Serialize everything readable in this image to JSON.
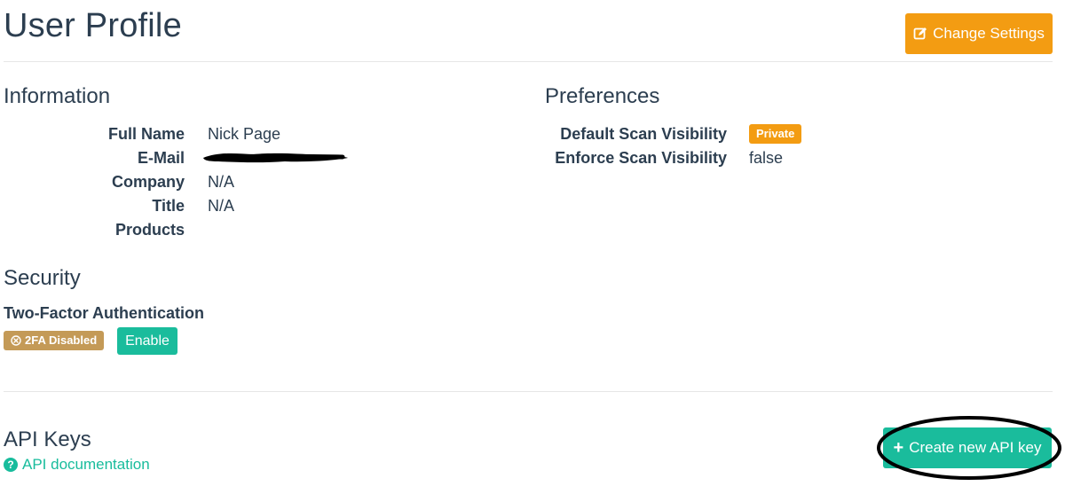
{
  "header": {
    "title": "User Profile",
    "change_settings_label": "Change Settings"
  },
  "information": {
    "heading": "Information",
    "fields": [
      {
        "label": "Full Name",
        "value": "Nick Page"
      },
      {
        "label": "E-Mail",
        "value": ""
      },
      {
        "label": "Company",
        "value": "N/A"
      },
      {
        "label": "Title",
        "value": "N/A"
      },
      {
        "label": "Products",
        "value": ""
      }
    ]
  },
  "preferences": {
    "heading": "Preferences",
    "fields": [
      {
        "label": "Default Scan Visibility",
        "value": "Private"
      },
      {
        "label": "Enforce Scan Visibility",
        "value": "false"
      }
    ]
  },
  "security": {
    "heading": "Security",
    "tfa_label": "Two-Factor Authentication",
    "tfa_status": "2FA Disabled",
    "enable_label": "Enable"
  },
  "api_keys": {
    "heading": "API Keys",
    "doc_link": "API documentation",
    "create_label": "Create new API key"
  },
  "colors": {
    "warning": "#f39c12",
    "success": "#1abc9c",
    "tfa_badge": "#c49a57",
    "text": "#2c3e50"
  },
  "icons": {
    "change_settings": "edit-icon",
    "tfa_status": "circle-x-icon",
    "doc_link": "question-circle-icon",
    "create": "plus-icon"
  }
}
